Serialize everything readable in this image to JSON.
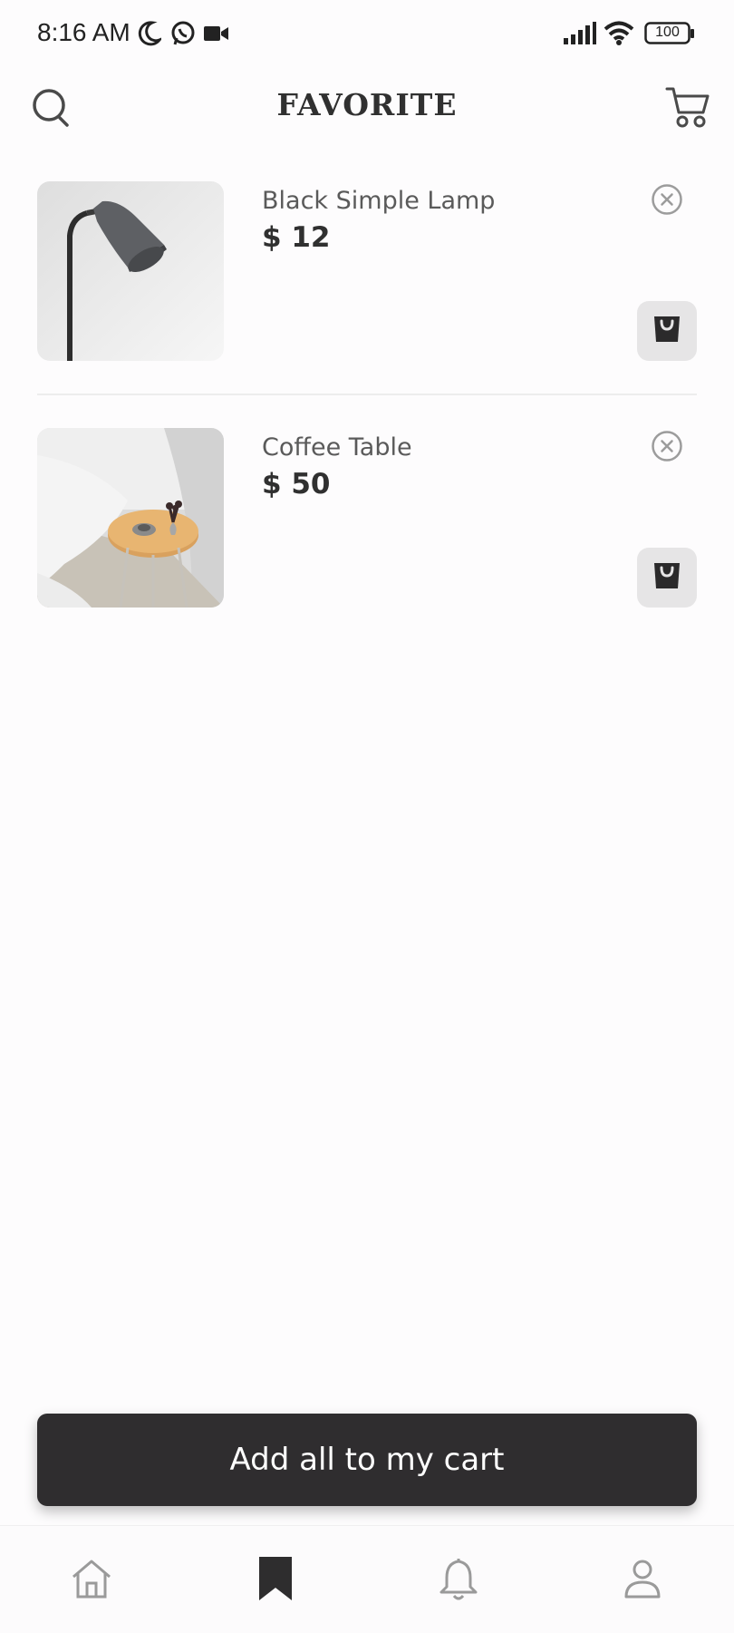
{
  "status_bar": {
    "time": "8:16 AM",
    "icons": [
      "moon-icon",
      "whatsapp-icon",
      "video-camera-icon",
      "signal-icon",
      "wifi-icon",
      "battery-icon"
    ],
    "battery": "100"
  },
  "header": {
    "title": "FAVORITE",
    "left_icon": "search-icon",
    "right_icon": "cart-icon"
  },
  "favorites": [
    {
      "name": "Black Simple Lamp",
      "price": "$ 12",
      "image": "floor-lamp-photo"
    },
    {
      "name": "Coffee Table",
      "price": "$ 50",
      "image": "coffee-table-photo"
    }
  ],
  "cta": {
    "label": "Add all to my cart"
  },
  "bottom_nav": {
    "items": [
      {
        "icon": "home-icon",
        "active": false
      },
      {
        "icon": "bookmark-icon",
        "active": true
      },
      {
        "icon": "bell-icon",
        "active": false
      },
      {
        "icon": "profile-icon",
        "active": false
      }
    ]
  },
  "colors": {
    "background": "#fdfcfd",
    "primary_dark": "#2f2d2f",
    "button_light": "#e6e5e6",
    "muted_icon": "#999999"
  }
}
